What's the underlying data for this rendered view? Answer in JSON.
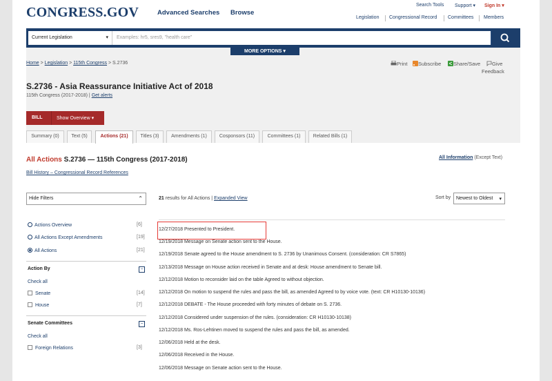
{
  "logo": "CONGRESS.GOV",
  "header": {
    "advanced_searches": "Advanced Searches",
    "browse": "Browse",
    "search_tools": "Search Tools",
    "support": "Support ▾",
    "sign_in": "Sign In ▾",
    "subnav": [
      "Legislation",
      "Congressional Record",
      "Committees",
      "Members"
    ]
  },
  "search": {
    "scope": "Current Legislation",
    "placeholder": "Examples: hr5, sres9, \"health care\"",
    "more_options": "MORE OPTIONS ▾"
  },
  "breadcrumb": {
    "home": "Home",
    "legislation": "Legislation",
    "congress": "115th Congress",
    "current": "S.2736"
  },
  "tools": {
    "print": "Print",
    "subscribe": "Subscribe",
    "share": "Share/Save",
    "give": "Give",
    "feedback": "Feedback"
  },
  "bill": {
    "title": "S.2736 - Asia Reassurance Initiative Act of 2018",
    "congress": "115th Congress (2017-2018)",
    "get_alerts": "Get alerts",
    "label": "BILL",
    "show_overview": "Show Overview ▾"
  },
  "tabs": [
    "Summary (0)",
    "Text (5)",
    "Actions (21)",
    "Titles (3)",
    "Amendments (1)",
    "Cosponsors (11)",
    "Committees (1)",
    "Related Bills (1)"
  ],
  "section": {
    "all_actions": "All Actions",
    "rest": "S.2736 — 115th Congress (2017-2018)",
    "all_information": "All Information",
    "except_text": "(Except Text)",
    "bill_history": "Bill History – Congressional Record References"
  },
  "filters": {
    "hide_filters": "Hide Filters",
    "radios": [
      {
        "label": "Actions Overview",
        "count": "[6]"
      },
      {
        "label": "All Actions Except Amendments",
        "count": "[19]"
      },
      {
        "label": "All Actions",
        "count": "[21]"
      }
    ],
    "action_by": "Action By",
    "check_all": "Check all",
    "action_by_items": [
      {
        "label": "Senate",
        "count": "[14]"
      },
      {
        "label": "House",
        "count": "[7]"
      }
    ],
    "senate_committees": "Senate Committees",
    "committee_items": [
      {
        "label": "Foreign Relations",
        "count": "[3]"
      }
    ]
  },
  "results": {
    "count": "21",
    "label": "results for All Actions",
    "divider": "|",
    "expanded_view": "Expanded View",
    "sort_by": "Sort by",
    "sort_value": "Newest to Oldest"
  },
  "actions": [
    "12/27/2018 Presented to President.",
    "12/19/2018 Message on Senate action sent to the House.",
    "12/19/2018 Senate agreed to the House amendment to S. 2736 by Unanimous Consent. (consideration: CR S7865)",
    "12/13/2018 Message on House action received in Senate and at desk: House amendment to Senate bill.",
    "12/12/2018 Motion to reconsider laid on the table Agreed to without objection.",
    "12/12/2018 On motion to suspend the rules and pass the bill, as amended Agreed to by voice vote. (text: CR H10130-10136)",
    "12/12/2018 DEBATE - The House proceeded with forty minutes of debate on S. 2736.",
    "12/12/2018 Considered under suspension of the rules. (consideration: CR H10130-10138)",
    "12/12/2018 Ms. Ros-Lehtinen moved to suspend the rules and pass the bill, as amended.",
    "12/06/2018 Held at the desk.",
    "12/06/2018 Received in the House.",
    "12/06/2018 Message on Senate action sent to the House."
  ]
}
